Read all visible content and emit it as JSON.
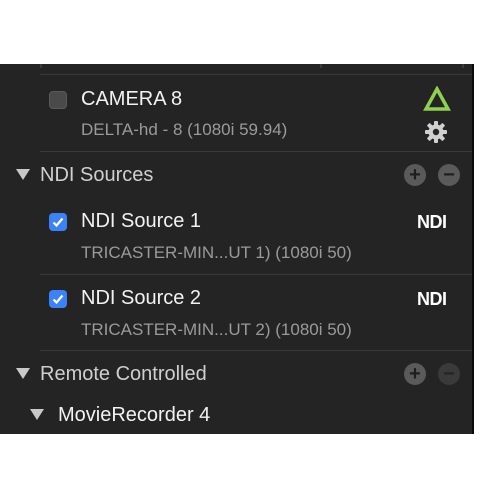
{
  "camera_row": {
    "title": "CAMERA 8",
    "subtitle": "DELTA-hd - 8 (1080i 59.94)",
    "checked": false,
    "status_icon": "triangle-delta-icon",
    "status_color": "#8fd14f",
    "settings_icon": "gear-icon"
  },
  "ndi_section": {
    "label": "NDI Sources",
    "add_icon": "plus-icon",
    "remove_icon": "minus-icon",
    "items": [
      {
        "title": "NDI Source 1",
        "subtitle": "TRICASTER-MIN...UT 1) (1080i 50)",
        "checked": true,
        "badge": "NDI"
      },
      {
        "title": "NDI Source 2",
        "subtitle": "TRICASTER-MIN...UT 2) (1080i 50)",
        "checked": true,
        "badge": "NDI"
      }
    ]
  },
  "remote_section": {
    "label": "Remote Controlled",
    "add_icon": "plus-icon",
    "remove_icon": "minus-icon",
    "items": [
      {
        "title": "MovieRecorder 4"
      }
    ]
  },
  "colors": {
    "panel_bg": "#242424",
    "accent_blue": "#3b82f6",
    "text_primary": "#f2f2f2",
    "text_secondary": "#9a9a9a"
  }
}
